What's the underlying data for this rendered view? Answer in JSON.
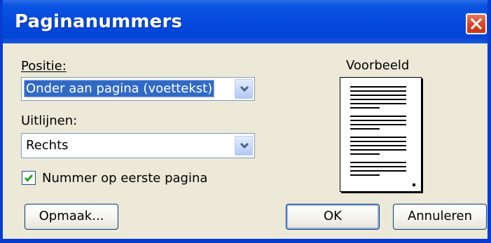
{
  "dialog": {
    "title": "Paginanummers"
  },
  "position": {
    "label": "Positie:",
    "value": "Onder aan pagina (voettekst)"
  },
  "alignment": {
    "label": "Uitlijnen:",
    "value": "Rechts"
  },
  "first_page": {
    "label": "Nummer op eerste pagina",
    "checked": true
  },
  "preview": {
    "label": "Voorbeeld"
  },
  "buttons": {
    "format": "Opmaak...",
    "ok": "OK",
    "cancel": "Annuleren"
  },
  "colors": {
    "title_bar": "#0349dd",
    "dialog_bg": "#ece9d8",
    "close_button": "#d8452a",
    "selection": "#316ac5",
    "checkmark": "#21a121"
  }
}
